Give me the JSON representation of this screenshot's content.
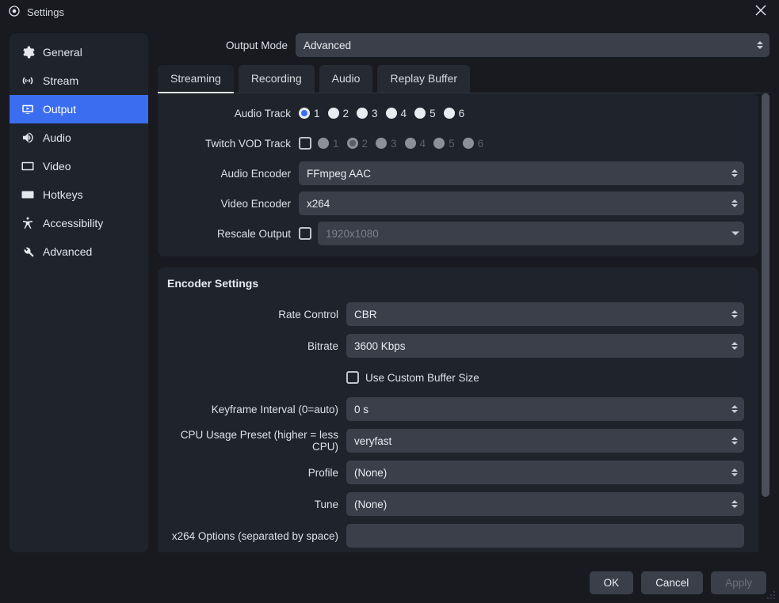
{
  "window": {
    "title": "Settings"
  },
  "sidebar": {
    "items": [
      {
        "label": "General"
      },
      {
        "label": "Stream"
      },
      {
        "label": "Output"
      },
      {
        "label": "Audio"
      },
      {
        "label": "Video"
      },
      {
        "label": "Hotkeys"
      },
      {
        "label": "Accessibility"
      },
      {
        "label": "Advanced"
      }
    ],
    "active_index": 2
  },
  "output_mode": {
    "label": "Output Mode",
    "value": "Advanced"
  },
  "tabs": [
    {
      "label": "Streaming"
    },
    {
      "label": "Recording"
    },
    {
      "label": "Audio"
    },
    {
      "label": "Replay Buffer"
    }
  ],
  "active_tab_index": 0,
  "streaming": {
    "audio_track": {
      "label": "Audio Track",
      "options": [
        "1",
        "2",
        "3",
        "4",
        "5",
        "6"
      ],
      "selected": "1"
    },
    "twitch_vod": {
      "label": "Twitch VOD Track",
      "enabled": false,
      "options": [
        "1",
        "2",
        "3",
        "4",
        "5",
        "6"
      ],
      "selected": "2"
    },
    "audio_encoder": {
      "label": "Audio Encoder",
      "value": "FFmpeg AAC"
    },
    "video_encoder": {
      "label": "Video Encoder",
      "value": "x264"
    },
    "rescale_output": {
      "label": "Rescale Output",
      "enabled": false,
      "value": "1920x1080"
    }
  },
  "encoder": {
    "section_title": "Encoder Settings",
    "rate_control": {
      "label": "Rate Control",
      "value": "CBR"
    },
    "bitrate": {
      "label": "Bitrate",
      "value": "3600 Kbps"
    },
    "custom_buffer": {
      "label": "Use Custom Buffer Size",
      "enabled": false
    },
    "keyframe": {
      "label": "Keyframe Interval (0=auto)",
      "value": "0 s"
    },
    "cpu_preset": {
      "label": "CPU Usage Preset (higher = less CPU)",
      "value": "veryfast"
    },
    "profile": {
      "label": "Profile",
      "value": "(None)"
    },
    "tune": {
      "label": "Tune",
      "value": "(None)"
    },
    "x264_opts": {
      "label": "x264 Options (separated by space)",
      "value": ""
    }
  },
  "footer": {
    "ok": "OK",
    "cancel": "Cancel",
    "apply": "Apply"
  }
}
